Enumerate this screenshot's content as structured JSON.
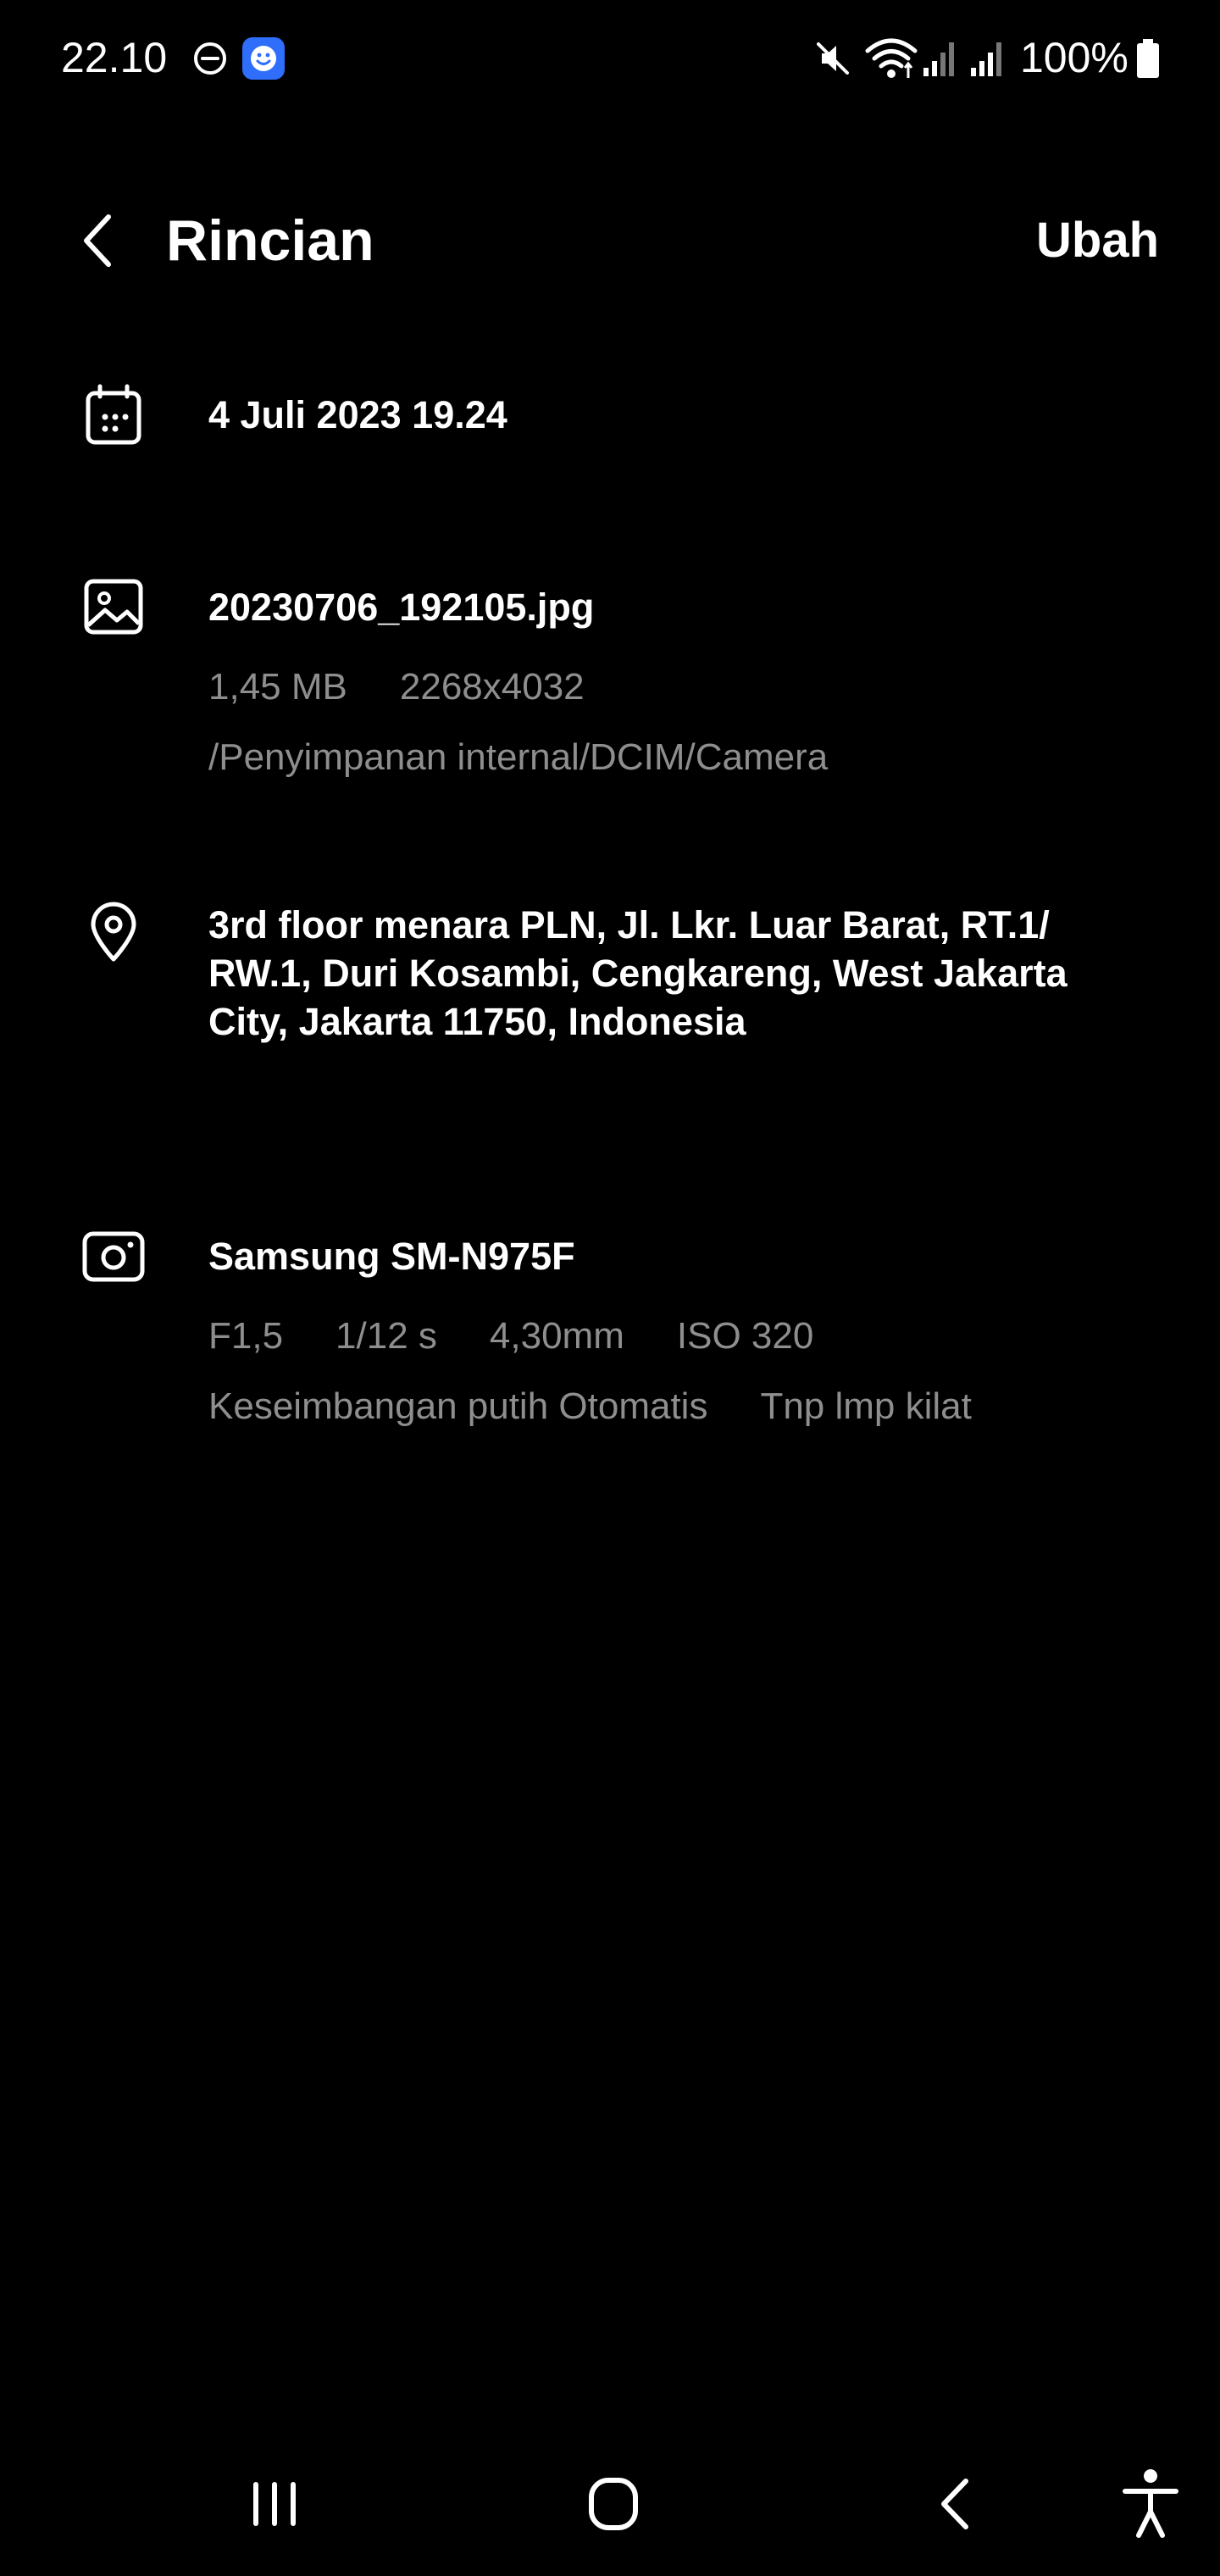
{
  "status_bar": {
    "time": "22.10",
    "battery": "100%",
    "icons": [
      "do-not-disturb-icon",
      "app-notification-icon",
      "mute-icon",
      "wifi-icon",
      "signal-icon",
      "signal-icon",
      "battery-icon"
    ]
  },
  "header": {
    "back_icon": "back-arrow-icon",
    "title": "Rincian",
    "edit_label": "Ubah"
  },
  "details": {
    "date": {
      "icon": "calendar-icon",
      "text": "4 Juli 2023 19.24"
    },
    "file": {
      "icon": "image-icon",
      "name": "20230706_192105.jpg",
      "size": "1,45 MB",
      "resolution": "2268x4032",
      "path": "/Penyimpanan internal/DCIM/Camera"
    },
    "location": {
      "icon": "location-pin-icon",
      "address": "3rd floor menara PLN, Jl. Lkr. Luar Barat, RT.1/ RW.1, Duri Kosambi, Cengkareng, West Jakarta City, Jakarta 11750, Indonesia"
    },
    "camera": {
      "icon": "camera-icon",
      "model": "Samsung SM-N975F",
      "aperture": "F1,5",
      "shutter": "1/12 s",
      "focal_length": "4,30mm",
      "iso": "ISO 320",
      "white_balance": "Keseimbangan putih Otomatis",
      "flash": "Tnp lmp kilat"
    }
  },
  "nav_bar": {
    "buttons": [
      "recent-apps-icon",
      "home-icon",
      "back-icon",
      "accessibility-icon"
    ]
  }
}
